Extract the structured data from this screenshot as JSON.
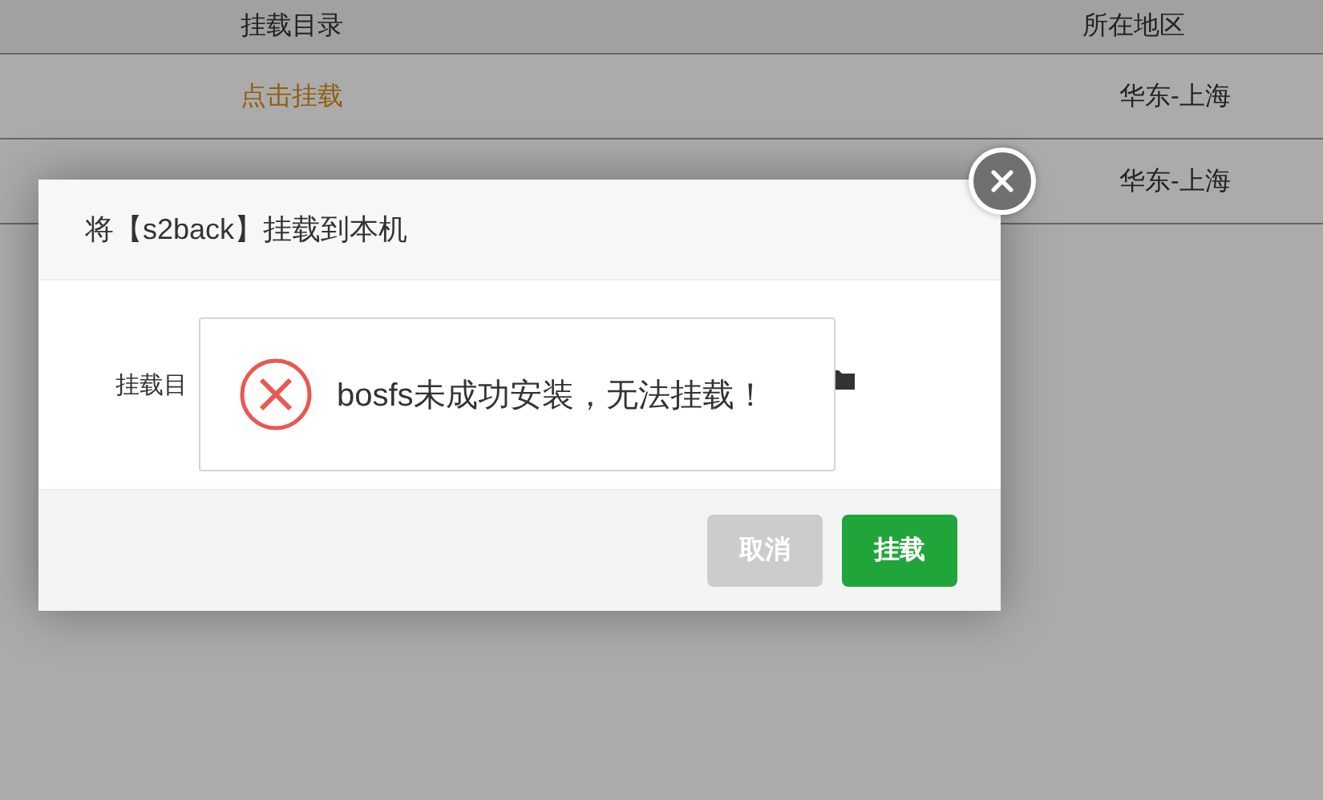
{
  "table": {
    "columns": [
      "挂载目录",
      "所在地区"
    ],
    "rows": [
      {
        "action": "点击挂载",
        "region": "华东-上海"
      },
      {
        "region": "华东-上海"
      }
    ]
  },
  "dialog": {
    "title": "将【s2back】挂载到本机",
    "field_label": "挂载目",
    "buttons": [
      {
        "label": "取消",
        "kind": "cancel"
      },
      {
        "label": "挂载",
        "kind": "primary"
      }
    ]
  },
  "message": {
    "kind": "error",
    "text": "bosfs未成功安装，无法挂载！"
  }
}
